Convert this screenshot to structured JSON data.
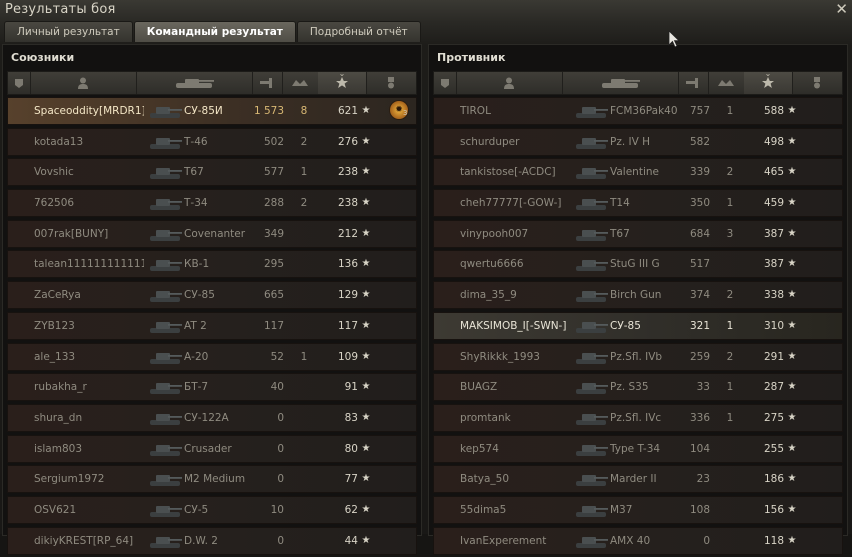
{
  "window": {
    "title": "Результаты боя",
    "close_glyph": "✕"
  },
  "tabs": [
    "Личный результат",
    "Командный результат",
    "Подробный отчёт"
  ],
  "allies": {
    "title": "Союзники",
    "rows": [
      {
        "player": "Spaceoddity[MRDR1]",
        "tank": "СУ-85И",
        "damage": "1 573",
        "frags": "8",
        "xp": "621",
        "medal": "3"
      },
      {
        "player": "kotada13",
        "tank": "Т-46",
        "damage": "502",
        "frags": "2",
        "xp": "276"
      },
      {
        "player": "Vovshic",
        "tank": "T67",
        "damage": "577",
        "frags": "1",
        "xp": "238"
      },
      {
        "player": "762506",
        "tank": "Т-34",
        "damage": "288",
        "frags": "2",
        "xp": "238"
      },
      {
        "player": "007rak[BUNY]",
        "tank": "Covenanter",
        "damage": "349",
        "frags": "",
        "xp": "212"
      },
      {
        "player": "talean111111111111...",
        "tank": "КВ-1",
        "damage": "295",
        "frags": "",
        "xp": "136"
      },
      {
        "player": "ZaCeRya",
        "tank": "СУ-85",
        "damage": "665",
        "frags": "",
        "xp": "129"
      },
      {
        "player": "ZYB123",
        "tank": "AT 2",
        "damage": "117",
        "frags": "",
        "xp": "117"
      },
      {
        "player": "ale_133",
        "tank": "А-20",
        "damage": "52",
        "frags": "1",
        "xp": "109"
      },
      {
        "player": "rubakha_r",
        "tank": "БТ-7",
        "damage": "40",
        "frags": "",
        "xp": "91"
      },
      {
        "player": "shura_dn",
        "tank": "СУ-122А",
        "damage": "0",
        "frags": "",
        "xp": "83"
      },
      {
        "player": "islam803",
        "tank": "Crusader",
        "damage": "0",
        "frags": "",
        "xp": "80"
      },
      {
        "player": "Sergium1972",
        "tank": "M2 Medium",
        "damage": "0",
        "frags": "",
        "xp": "77"
      },
      {
        "player": "OSV621",
        "tank": "СУ-5",
        "damage": "10",
        "frags": "",
        "xp": "62"
      },
      {
        "player": "dikiyKREST[RP_64]",
        "tank": "D.W. 2",
        "damage": "0",
        "frags": "",
        "xp": "44"
      }
    ]
  },
  "enemies": {
    "title": "Противник",
    "rows": [
      {
        "player": "TIROL",
        "tank": "FCM36Pak40",
        "damage": "757",
        "frags": "1",
        "xp": "588"
      },
      {
        "player": "schurduper",
        "tank": "Pz. IV H",
        "damage": "582",
        "frags": "",
        "xp": "498"
      },
      {
        "player": "tankistose[-ACDC]",
        "tank": "Valentine",
        "damage": "339",
        "frags": "2",
        "xp": "465"
      },
      {
        "player": "cheh77777[-GOW-]",
        "tank": "T14",
        "damage": "350",
        "frags": "1",
        "xp": "459"
      },
      {
        "player": "vinypooh007",
        "tank": "T67",
        "damage": "684",
        "frags": "3",
        "xp": "387"
      },
      {
        "player": "qwertu6666",
        "tank": "StuG III G",
        "damage": "517",
        "frags": "",
        "xp": "387"
      },
      {
        "player": "dima_35_9",
        "tank": "Birch Gun",
        "damage": "374",
        "frags": "2",
        "xp": "338"
      },
      {
        "player": "MAKSIMOB_I[-SWN-]",
        "tank": "СУ-85",
        "damage": "321",
        "frags": "1",
        "xp": "310",
        "highlight": true
      },
      {
        "player": "ShyRikkk_1993",
        "tank": "Pz.Sfl. IVb",
        "damage": "259",
        "frags": "2",
        "xp": "291"
      },
      {
        "player": "BUAGZ",
        "tank": "Pz. S35",
        "damage": "33",
        "frags": "1",
        "xp": "287"
      },
      {
        "player": "promtank",
        "tank": "Pz.Sfl. IVc",
        "damage": "336",
        "frags": "1",
        "xp": "275"
      },
      {
        "player": "kep574",
        "tank": "Type T-34",
        "damage": "104",
        "frags": "",
        "xp": "255"
      },
      {
        "player": "Batya_50",
        "tank": "Marder II",
        "damage": "23",
        "frags": "",
        "xp": "186"
      },
      {
        "player": "55dima5",
        "tank": "M37",
        "damage": "108",
        "frags": "",
        "xp": "156"
      },
      {
        "player": "IvanExperement",
        "tank": "AMX 40",
        "damage": "0",
        "frags": "",
        "xp": "118"
      }
    ]
  },
  "icons": {
    "columns": [
      "platoon-icon",
      "player-icon",
      "tank-icon",
      "damage-icon",
      "frags-icon",
      "xp-star-icon",
      "medal-icon"
    ],
    "star": "★"
  }
}
